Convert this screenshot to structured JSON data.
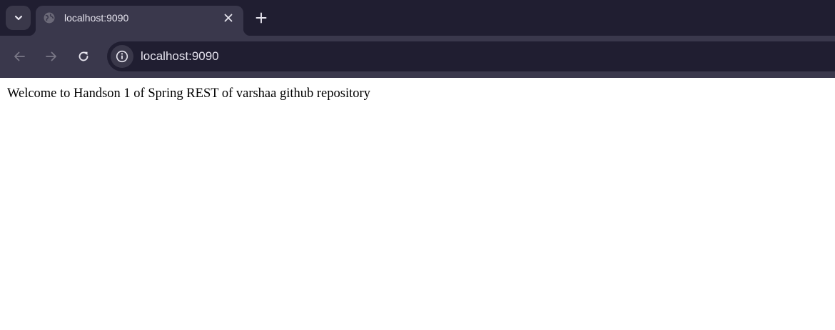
{
  "browser": {
    "tab": {
      "title": "localhost:9090"
    },
    "address_bar": {
      "url": "localhost:9090"
    },
    "colors": {
      "tabstrip": "#201e31",
      "toolbar": "#3a384c",
      "omnibox": "#201e31",
      "text": "#e3e1ec"
    },
    "icons": {
      "tab_search": "chevron-down-icon",
      "favicon": "globe-icon",
      "tab_close": "close-icon",
      "new_tab": "plus-icon",
      "back": "arrow-left-icon",
      "forward": "arrow-right-icon",
      "reload": "reload-icon",
      "site_info": "info-icon"
    }
  },
  "page": {
    "message": "Welcome to Handson 1 of Spring REST of varshaa github repository"
  }
}
